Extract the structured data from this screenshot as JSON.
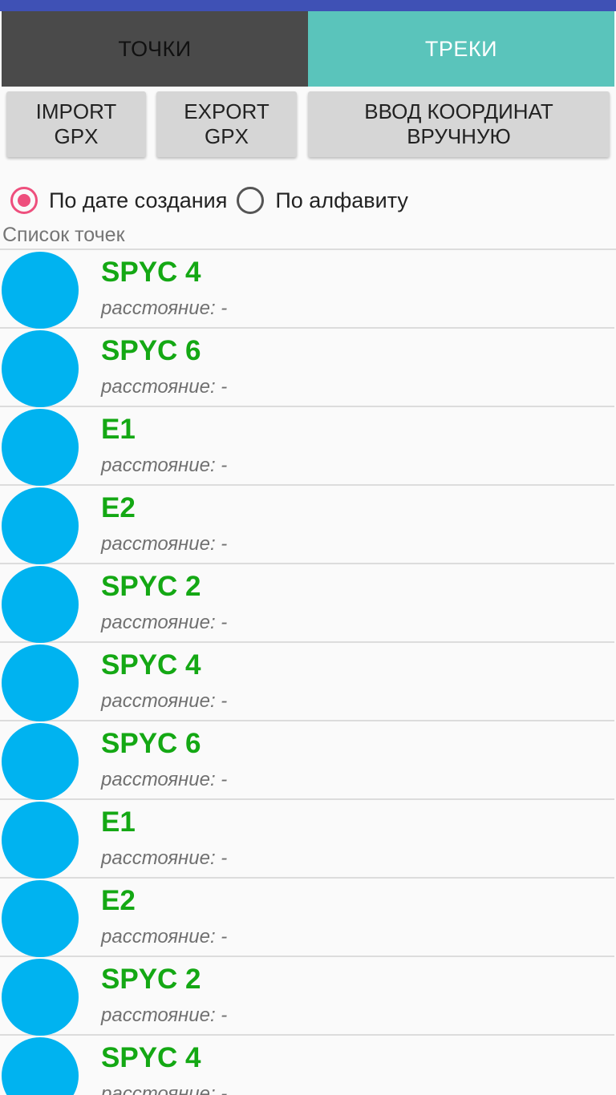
{
  "tabs": {
    "points": "ТОЧКИ",
    "tracks": "ТРЕКИ"
  },
  "buttons": {
    "import_gpx": "IMPORT\nGPX",
    "export_gpx": "EXPORT\nGPX",
    "manual_input": "ВВОД КООРДИНАТ\nВРУЧНУЮ"
  },
  "sort": {
    "by_date": "По дате создания",
    "by_alphabet": "По алфавиту",
    "selected": "by_date"
  },
  "list": {
    "header": "Список точек",
    "items": [
      {
        "name": "SPYC 4",
        "distance": "расстояние: -"
      },
      {
        "name": "SPYC 6",
        "distance": "расстояние: -"
      },
      {
        "name": "E1",
        "distance": "расстояние: -"
      },
      {
        "name": "E2",
        "distance": "расстояние: -"
      },
      {
        "name": "SPYC 2",
        "distance": "расстояние: -"
      },
      {
        "name": "SPYC 4",
        "distance": "расстояние: -"
      },
      {
        "name": "SPYC 6",
        "distance": "расстояние: -"
      },
      {
        "name": "E1",
        "distance": "расстояние: -"
      },
      {
        "name": "E2",
        "distance": "расстояние: -"
      },
      {
        "name": "SPYC 2",
        "distance": "расстояние: -"
      },
      {
        "name": "SPYC 4",
        "distance": "расстояние: -"
      }
    ]
  },
  "colors": {
    "status_bar": "#3f51b5",
    "tab_inactive": "#4a4a4a",
    "tab_active": "#5ac4bb",
    "radio_accent": "#ee4f7d",
    "avatar": "#00b3f0",
    "item_name": "#14a814"
  }
}
